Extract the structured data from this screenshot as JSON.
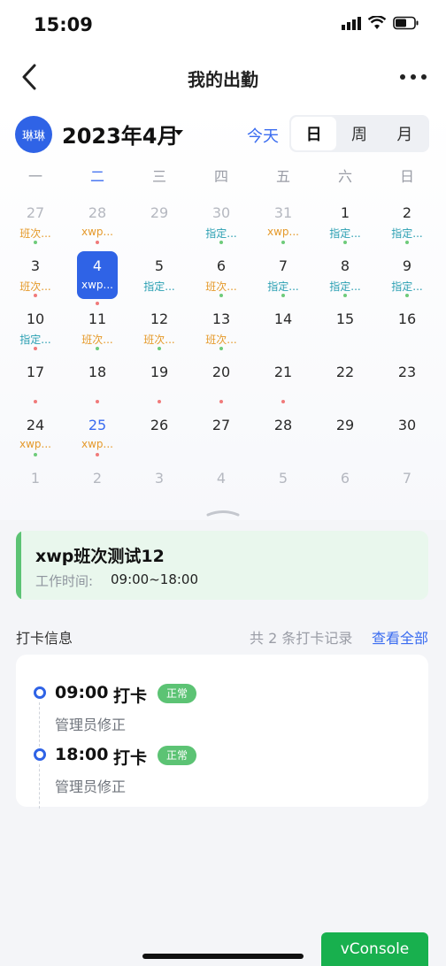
{
  "status": {
    "time": "15:09"
  },
  "nav": {
    "title": "我的出勤"
  },
  "header": {
    "avatar_text": "琳琳",
    "month": "2023年4月",
    "today": "今天",
    "views": [
      {
        "label": "日",
        "active": true
      },
      {
        "label": "周",
        "active": false
      },
      {
        "label": "月",
        "active": false
      }
    ]
  },
  "weekdays": [
    "一",
    "二",
    "三",
    "四",
    "五",
    "六",
    "日"
  ],
  "calendar": [
    [
      {
        "d": "27",
        "other": true,
        "label": "班次...",
        "lc": "orange",
        "dot": "green"
      },
      {
        "d": "28",
        "other": true,
        "label": "xwp...",
        "lc": "orange",
        "dot": "red"
      },
      {
        "d": "29",
        "other": true
      },
      {
        "d": "30",
        "other": true,
        "label": "指定...",
        "lc": "teal",
        "dot": "green"
      },
      {
        "d": "31",
        "other": true,
        "label": "xwp...",
        "lc": "orange",
        "dot": "green"
      },
      {
        "d": "1",
        "label": "指定...",
        "lc": "teal",
        "dot": "green"
      },
      {
        "d": "2",
        "label": "指定...",
        "lc": "teal",
        "dot": "green"
      }
    ],
    [
      {
        "d": "3",
        "label": "班次...",
        "lc": "orange",
        "dot": "red"
      },
      {
        "d": "4",
        "selected": true,
        "label": "xwp...",
        "lc": "orange",
        "dot": "red"
      },
      {
        "d": "5",
        "label": "指定...",
        "lc": "teal"
      },
      {
        "d": "6",
        "label": "班次...",
        "lc": "orange",
        "dot": "green"
      },
      {
        "d": "7",
        "label": "指定...",
        "lc": "teal",
        "dot": "green"
      },
      {
        "d": "8",
        "label": "指定...",
        "lc": "teal",
        "dot": "green"
      },
      {
        "d": "9",
        "label": "指定...",
        "lc": "teal",
        "dot": "green"
      }
    ],
    [
      {
        "d": "10",
        "label": "指定...",
        "lc": "teal",
        "dot": "red"
      },
      {
        "d": "11",
        "label": "班次...",
        "lc": "orange",
        "dot": "green"
      },
      {
        "d": "12",
        "label": "班次...",
        "lc": "orange",
        "dot": "green"
      },
      {
        "d": "13",
        "label": "班次...",
        "lc": "orange",
        "dot": "green"
      },
      {
        "d": "14"
      },
      {
        "d": "15"
      },
      {
        "d": "16"
      }
    ],
    [
      {
        "d": "17",
        "dot": "red"
      },
      {
        "d": "18",
        "dot": "red"
      },
      {
        "d": "19",
        "dot": "red"
      },
      {
        "d": "20",
        "dot": "red"
      },
      {
        "d": "21",
        "dot": "red"
      },
      {
        "d": "22"
      },
      {
        "d": "23"
      }
    ],
    [
      {
        "d": "24",
        "label": "xwp...",
        "lc": "orange",
        "dot": "green"
      },
      {
        "d": "25",
        "blue": true,
        "label": "xwp...",
        "lc": "orange",
        "dot": "red"
      },
      {
        "d": "26"
      },
      {
        "d": "27"
      },
      {
        "d": "28"
      },
      {
        "d": "29"
      },
      {
        "d": "30"
      }
    ],
    [
      {
        "d": "1",
        "other": true
      },
      {
        "d": "2",
        "other": true
      },
      {
        "d": "3",
        "other": true
      },
      {
        "d": "4",
        "other": true
      },
      {
        "d": "5",
        "other": true
      },
      {
        "d": "6",
        "other": true
      },
      {
        "d": "7",
        "other": true
      }
    ]
  ],
  "shift": {
    "name": "xwp班次测试12",
    "time_label": "工作时间:",
    "time_value": "09:00~18:00"
  },
  "punch": {
    "title": "打卡信息",
    "count": "共 2 条打卡记录",
    "view_all": "查看全部",
    "records": [
      {
        "time": "09:00",
        "type": "打卡",
        "status": "正常",
        "note": "管理员修正"
      },
      {
        "time": "18:00",
        "type": "打卡",
        "status": "正常",
        "note": "管理员修正"
      }
    ]
  },
  "vconsole": "vConsole"
}
